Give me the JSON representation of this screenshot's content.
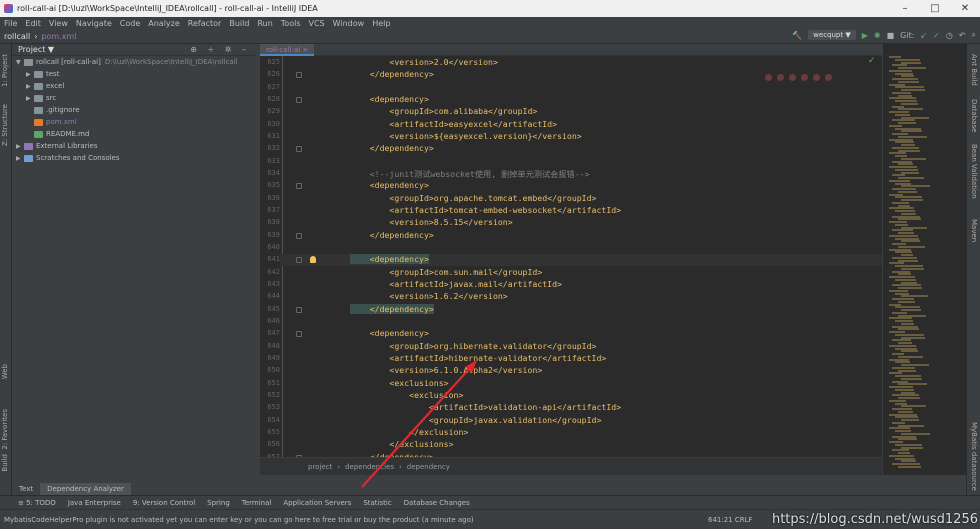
{
  "window": {
    "title": "roll-call-ai [D:\\luzl\\WorkSpace\\IntelliJ_IDEA\\rollcall] - roll-call-ai - IntelliJ IDEA",
    "minimize": "–",
    "maximize": "□",
    "close": "✕"
  },
  "menu": [
    "File",
    "Edit",
    "View",
    "Navigate",
    "Code",
    "Analyze",
    "Refactor",
    "Build",
    "Run",
    "Tools",
    "VCS",
    "Window",
    "Help"
  ],
  "nav": {
    "project": "rollcall",
    "file": "pom.xml"
  },
  "toolbar": {
    "run_config": "wecqupt ▼",
    "git_label": "Git:"
  },
  "left_tabs": [
    "1: Project",
    "Z: Structure",
    "Web",
    "2: Favorites",
    "Build"
  ],
  "right_tabs": [
    "Ant Build",
    "Database",
    "Bean Validation",
    "Maven",
    "MyBatis datasource"
  ],
  "project_panel": {
    "header": "Project ▼",
    "items": [
      {
        "name": "rollcall [roll-call-ai]",
        "path": "D:\\luzl\\WorkSpace\\IntelliJ_IDEA\\rollcall",
        "indent": 0,
        "arrow": "▼",
        "type": "dirc"
      },
      {
        "name": "test",
        "indent": 1,
        "arrow": "▶",
        "type": "dirc"
      },
      {
        "name": "excel",
        "indent": 1,
        "arrow": "▶",
        "type": "dirc"
      },
      {
        "name": "src",
        "indent": 1,
        "arrow": "▶",
        "type": "dirc"
      },
      {
        "name": ".gitignore",
        "indent": 1,
        "arrow": "",
        "type": "dirc"
      },
      {
        "name": "pom.xml",
        "indent": 1,
        "arrow": "",
        "type": "xml"
      },
      {
        "name": "README.md",
        "indent": 1,
        "arrow": "",
        "type": "md"
      },
      {
        "name": "External Libraries",
        "indent": 0,
        "arrow": "▶",
        "type": "lib"
      },
      {
        "name": "Scratches and Consoles",
        "indent": 0,
        "arrow": "▶",
        "type": "blue"
      }
    ]
  },
  "editor": {
    "tab": "roll-call-ai ×",
    "lines": [
      {
        "n": "625",
        "code": "        <version>2.0</version>",
        "kind": "tag"
      },
      {
        "n": "626",
        "code": "    </dependency>",
        "kind": "tag"
      },
      {
        "n": "627",
        "code": "",
        "kind": "tag"
      },
      {
        "n": "628",
        "code": "    <dependency>",
        "kind": "tag"
      },
      {
        "n": "629",
        "code": "        <groupId>com.alibaba</groupId>",
        "kind": "tag"
      },
      {
        "n": "630",
        "code": "        <artifactId>easyexcel</artifactId>",
        "kind": "tag"
      },
      {
        "n": "631",
        "code": "        <version>${easyexcel.version}</version>",
        "kind": "tag"
      },
      {
        "n": "632",
        "code": "    </dependency>",
        "kind": "tag"
      },
      {
        "n": "633",
        "code": "",
        "kind": "tag"
      },
      {
        "n": "634",
        "code": "    <!--junit测试websocket使用, 删掉单元测试会报错-->",
        "kind": "cm"
      },
      {
        "n": "635",
        "code": "    <dependency>",
        "kind": "tag"
      },
      {
        "n": "636",
        "code": "        <groupId>org.apache.tomcat.embed</groupId>",
        "kind": "tag"
      },
      {
        "n": "637",
        "code": "        <artifactId>tomcat-embed-websocket</artifactId>",
        "kind": "tag"
      },
      {
        "n": "638",
        "code": "        <version>8.5.15</version>",
        "kind": "tag"
      },
      {
        "n": "639",
        "code": "    </dependency>",
        "kind": "tag"
      },
      {
        "n": "640",
        "code": "",
        "kind": "tag"
      },
      {
        "n": "641",
        "code": "    <dependency>",
        "kind": "cur"
      },
      {
        "n": "642",
        "code": "        <groupId>com.sun.mail</groupId>",
        "kind": "tag"
      },
      {
        "n": "643",
        "code": "        <artifactId>javax.mail</artifactId>",
        "kind": "tag"
      },
      {
        "n": "644",
        "code": "        <version>1.6.2</version>",
        "kind": "tag"
      },
      {
        "n": "645",
        "code": "    </dependency>",
        "kind": "hl"
      },
      {
        "n": "646",
        "code": "",
        "kind": "tag"
      },
      {
        "n": "647",
        "code": "    <dependency>",
        "kind": "tag"
      },
      {
        "n": "648",
        "code": "        <groupId>org.hibernate.validator</groupId>",
        "kind": "tag"
      },
      {
        "n": "649",
        "code": "        <artifactId>hibernate-validator</artifactId>",
        "kind": "tag"
      },
      {
        "n": "650",
        "code": "        <version>6.1.0.Alpha2</version>",
        "kind": "tag"
      },
      {
        "n": "651",
        "code": "        <exclusions>",
        "kind": "tag"
      },
      {
        "n": "652",
        "code": "            <exclusion>",
        "kind": "tag"
      },
      {
        "n": "653",
        "code": "                <artifactId>validation-api</artifactId>",
        "kind": "tag"
      },
      {
        "n": "654",
        "code": "                <groupId>javax.validation</groupId>",
        "kind": "tag"
      },
      {
        "n": "655",
        "code": "            </exclusion>",
        "kind": "tag"
      },
      {
        "n": "656",
        "code": "        </exclusions>",
        "kind": "tag"
      },
      {
        "n": "657",
        "code": "    </dependency>",
        "kind": "tag"
      }
    ],
    "breadcrumb": [
      "project",
      "›",
      "dependencies",
      "›",
      "dependency"
    ]
  },
  "bottom_tabs": [
    "Text",
    "Dependency Analyzer"
  ],
  "tool_windows": [
    "≡ 5: TODO",
    "Java Enterprise",
    "9: Version Control",
    "Spring",
    "Terminal",
    "Application Servers",
    "Statistic",
    "Database Changes"
  ],
  "status": {
    "message": "MybatisCodeHelperPro plugin is not activated yet you can enter key or you can go here to free trial or buy the product (a minute ago)",
    "position": "641:21  CRLF"
  },
  "watermark": "https://blog.csdn.net/wusd1256",
  "colors": {
    "tag": "#e8bf6a",
    "comment": "#808080",
    "text": "#a9b7c6",
    "annotation": "#e0282e"
  }
}
